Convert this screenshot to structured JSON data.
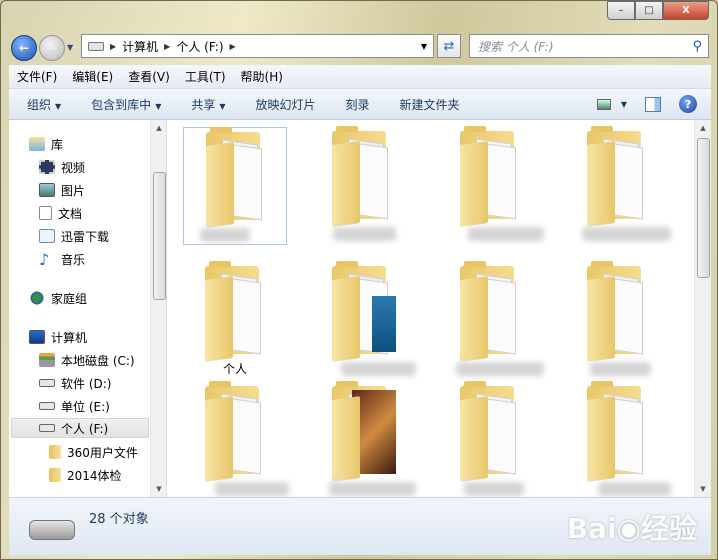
{
  "window": {
    "minimize": "–",
    "maximize": "□",
    "close": "X"
  },
  "address": {
    "crumbs": [
      "计算机",
      "个人 (F:)"
    ]
  },
  "search": {
    "placeholder": "搜索 个人 (F:)"
  },
  "menu": [
    "文件(F)",
    "编辑(E)",
    "查看(V)",
    "工具(T)",
    "帮助(H)"
  ],
  "toolbar": {
    "organize": "组织",
    "include": "包含到库中",
    "share": "共享",
    "slideshow": "放映幻灯片",
    "burn": "刻录",
    "new_folder": "新建文件夹",
    "help": "?"
  },
  "nav": {
    "library": "库",
    "video": "视频",
    "pictures": "图片",
    "documents": "文档",
    "xunlei": "迅雷下载",
    "music": "音乐",
    "homegroup": "家庭组",
    "computer": "计算机",
    "drive_c": "本地磁盘 (C:)",
    "drive_d": "软件 (D:)",
    "drive_e": "单位 (E:)",
    "drive_f": "个人 (F:)",
    "folder1": "360用户文件",
    "folder2": "2014体检"
  },
  "files": [
    {
      "label": ""
    },
    {
      "label": ""
    },
    {
      "label": ""
    },
    {
      "label": ""
    },
    {
      "label": "个人"
    },
    {
      "label": ""
    },
    {
      "label": ""
    },
    {
      "label": ""
    },
    {
      "label": ""
    },
    {
      "label": ""
    },
    {
      "label": ""
    },
    {
      "label": ""
    }
  ],
  "status": {
    "count": "28 个对象"
  },
  "watermark": "Bai 经验"
}
